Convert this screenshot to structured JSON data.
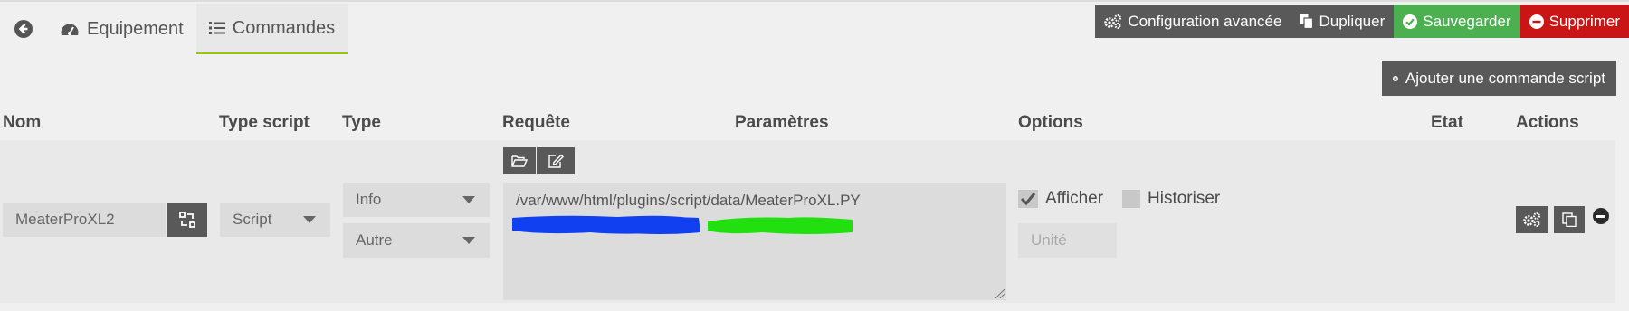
{
  "tabs": {
    "back_icon": "arrow-circle-left-icon",
    "items": [
      {
        "label": "Equipement",
        "icon": "tachometer-icon"
      },
      {
        "label": "Commandes",
        "icon": "list-icon"
      }
    ]
  },
  "toolbar": {
    "advanced_config": "Configuration avancée",
    "duplicate": "Dupliquer",
    "save": "Sauvegarder",
    "delete": "Supprimer"
  },
  "add_command": "Ajouter une commande script",
  "table": {
    "headers": {
      "name": "Nom",
      "script_type": "Type script",
      "type": "Type",
      "request": "Requête",
      "params": "Paramètres",
      "options": "Options",
      "state": "Etat",
      "actions": "Actions"
    },
    "row": {
      "name": "MeaterProXL2",
      "script_type": "Script",
      "type": "Info",
      "subtype": "Autre",
      "request": "/var/www/html/plugins/script/data/MeaterProXL.PY",
      "afficher_label": "Afficher",
      "afficher_checked": true,
      "historiser_label": "Historiser",
      "historiser_checked": false,
      "unit_placeholder": "Unité"
    }
  },
  "colors": {
    "dark_button": "#595959",
    "save": "#4caf50",
    "delete": "#c91515",
    "active_tab_border": "#94ca02",
    "redaction_blue": "#1040f0",
    "redaction_green": "#22e010"
  }
}
